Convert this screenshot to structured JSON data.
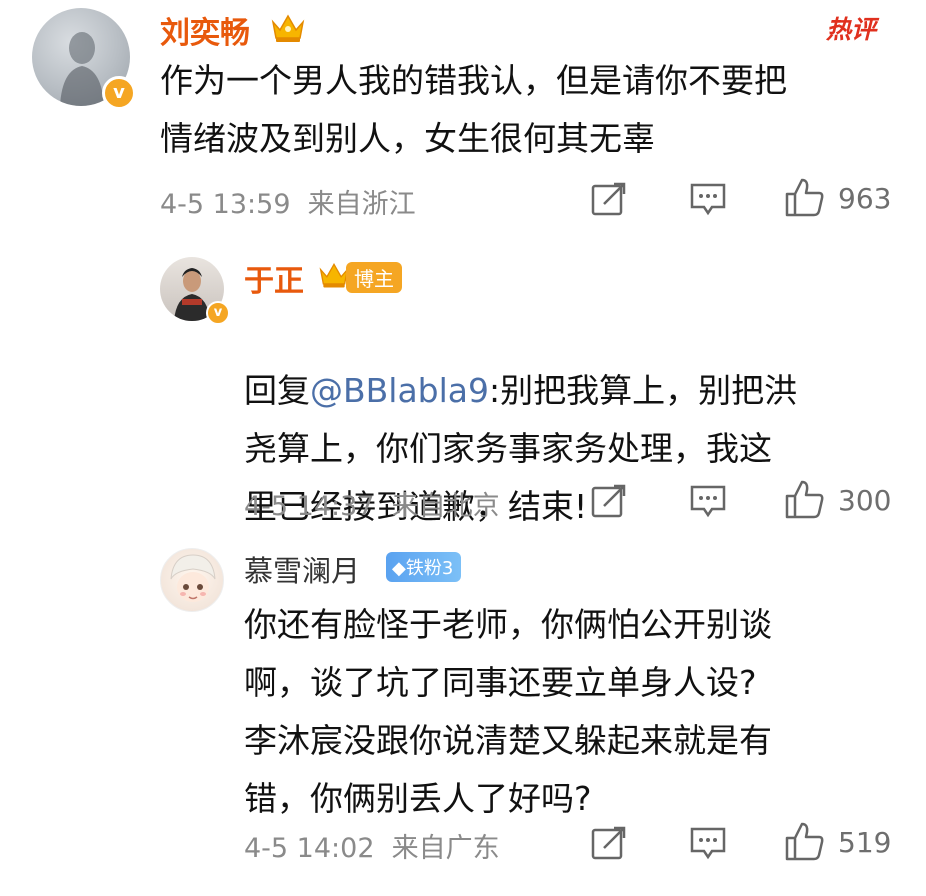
{
  "comments": [
    {
      "username": "刘奕畅",
      "hot_label": "热评",
      "text": "作为一个男人我的错我认，但是请你不要把\n情绪波及到别人，女生很何其无辜",
      "time": "4-5 13:59",
      "location": "来自浙江",
      "likes": "963"
    },
    {
      "username": "于正",
      "badge": "博主",
      "reply_prefix": "回复",
      "mention": "@BBlabla9",
      "text": ":别把我算上，别把洪\n尧算上，你们家务事家务处理，我这\n里已经接到道歉，结束!",
      "time": "4-5 14:37",
      "location": "来自北京",
      "likes": "300"
    },
    {
      "username": "慕雪澜月",
      "badge": "铁粉3",
      "text": "你还有脸怪于老师，你俩怕公开别谈\n啊，谈了坑了同事还要立单身人设?\n李沐宸没跟你说清楚又躲起来就是有\n错，你俩别丢人了好吗?",
      "time": "4-5 14:02",
      "location": "来自广东",
      "likes": "519"
    }
  ],
  "colors": {
    "username_primary": "#e8590c",
    "username_secondary": "#333333",
    "hot": "#e0301e",
    "mention": "#4b6fa8",
    "meta": "#8a8a8a"
  },
  "icons": [
    "crown-icon",
    "verified-icon",
    "share-icon",
    "comment-icon",
    "like-icon",
    "fan-diamond-icon"
  ]
}
